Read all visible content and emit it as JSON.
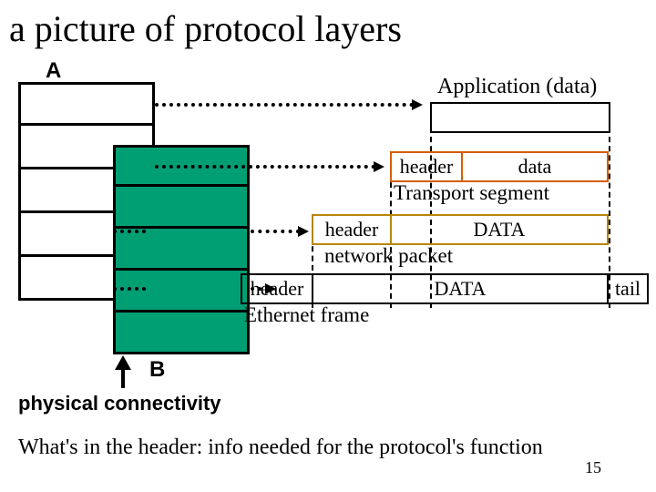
{
  "title": "a picture of protocol layers",
  "stacks": {
    "A": "A",
    "B": "B"
  },
  "phys_label": "physical connectivity",
  "application": {
    "label": "Application (data)"
  },
  "transport": {
    "header": "header",
    "data": "data",
    "label": "Transport segment"
  },
  "network": {
    "header": "header",
    "data": "DATA",
    "label": "network packet"
  },
  "ethernet": {
    "header": "header",
    "data": "DATA",
    "tail": "tail",
    "label": "Ethernet frame"
  },
  "footer": "What's in the header: info needed for the protocol's function",
  "page_number": "15"
}
